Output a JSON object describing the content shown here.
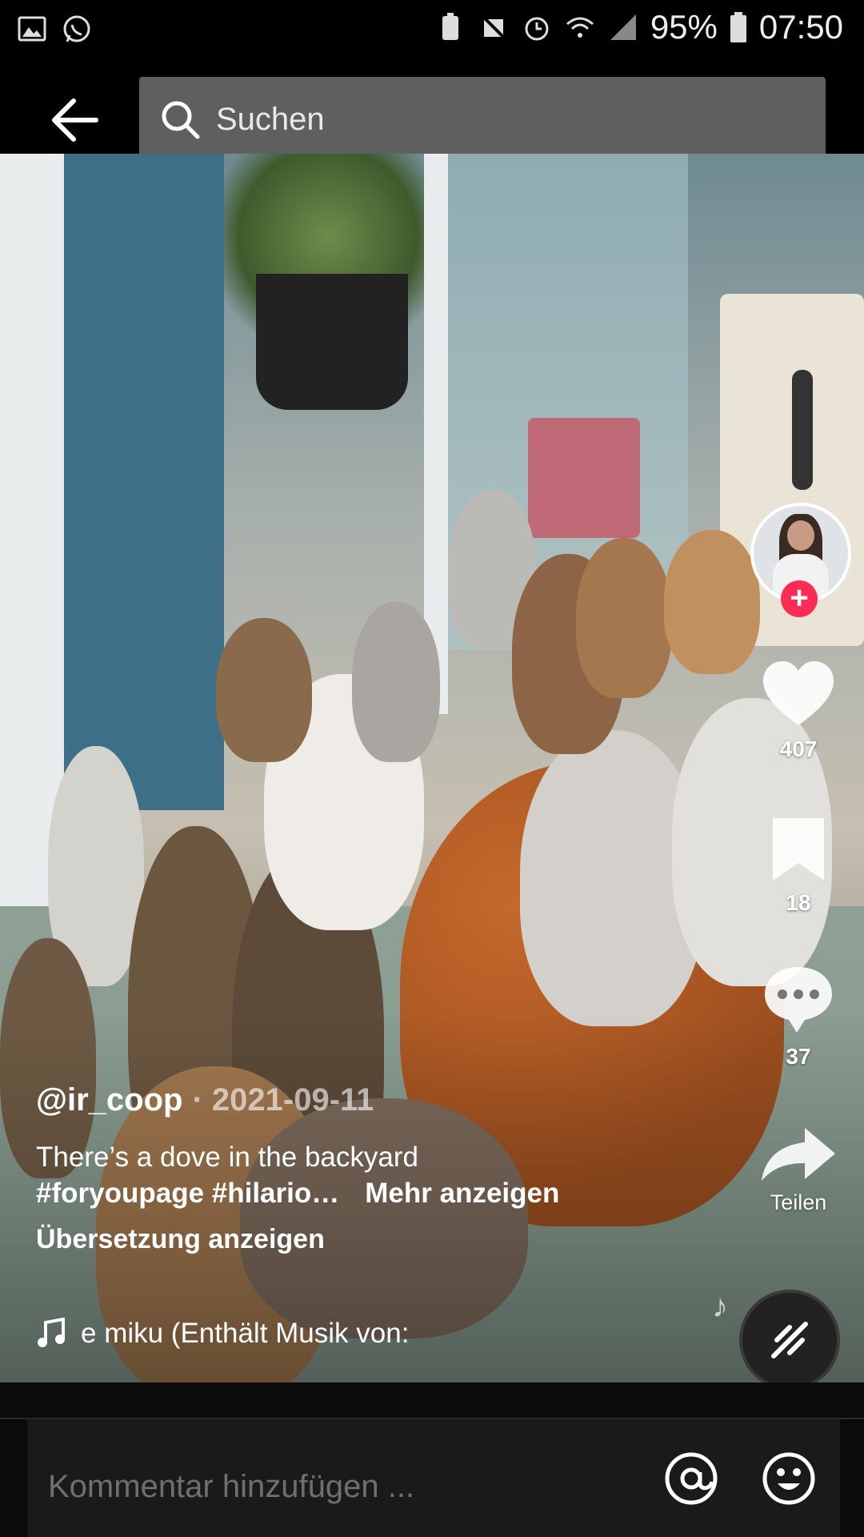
{
  "status_bar": {
    "battery_percent": "95%",
    "time": "07:50",
    "left_icons": [
      "gallery-icon",
      "whatsapp-icon"
    ],
    "right_icons": [
      "battery-saver-icon",
      "mute-icon",
      "alarm-icon",
      "wifi-icon",
      "signal-icon",
      "battery-icon"
    ]
  },
  "header": {
    "search_placeholder": "Suchen"
  },
  "post": {
    "author": "@ir_coop",
    "date": "· 2021-09-11",
    "description": "There’s a dove in the backyard",
    "hashtags": "#foryoupage #hilario…",
    "more_label": "Mehr anzeigen",
    "translate_label": "Übersetzung anzeigen",
    "music_text": "e miku (Enthält Musik von:"
  },
  "actions": {
    "likes": "407",
    "saves": "18",
    "comments": "37",
    "share_label": "Teilen",
    "follow_symbol": "+"
  },
  "comment_bar": {
    "placeholder": "Kommentar hinzufügen ..."
  },
  "colors": {
    "accent": "#fe2c55",
    "search_bg": "#5f5f5f",
    "background": "#000000"
  }
}
